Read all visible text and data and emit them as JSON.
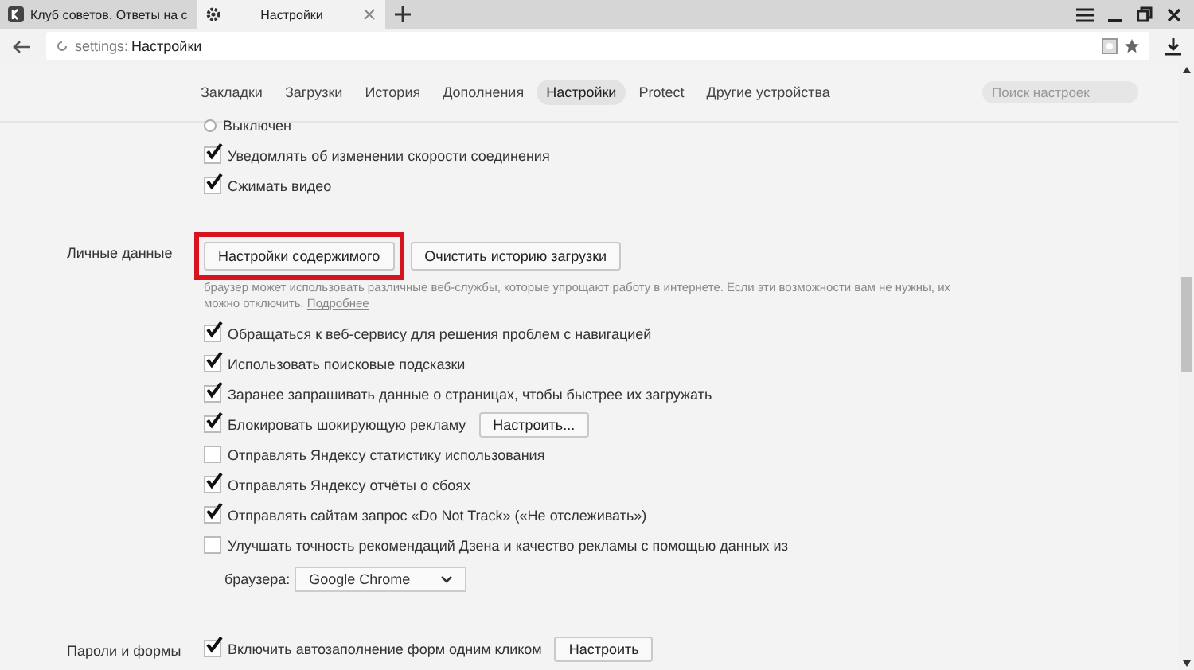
{
  "tabs": [
    {
      "title": "Клуб советов. Ответы на с",
      "selected": false
    },
    {
      "title": "Настройки",
      "selected": true
    }
  ],
  "address_bar": {
    "scheme": "settings:",
    "title": "Настройки"
  },
  "nav": {
    "items": [
      {
        "label": "Закладки",
        "selected": false
      },
      {
        "label": "Загрузки",
        "selected": false
      },
      {
        "label": "История",
        "selected": false
      },
      {
        "label": "Дополнения",
        "selected": false
      },
      {
        "label": "Настройки",
        "selected": true
      },
      {
        "label": "Protect",
        "selected": false
      },
      {
        "label": "Другие устройства",
        "selected": false
      }
    ],
    "search": {
      "placeholder": "Поиск настроек"
    }
  },
  "sections": [
    {
      "rows": [
        {
          "kind": "radio",
          "label": "Выключен",
          "selected": false
        },
        {
          "kind": "checkbox",
          "label": "Уведомлять об изменении скорости соединения",
          "checked": true
        },
        {
          "kind": "checkbox",
          "label": "Сжимать видео",
          "checked": true
        }
      ]
    },
    {
      "label": "Личные данные",
      "rows": [
        {
          "kind": "buttons",
          "buttons": [
            {
              "label": "Настройки содержимого",
              "highlighted": true
            },
            {
              "label": "Очистить историю загрузки",
              "highlighted": false
            }
          ]
        },
        {
          "kind": "description",
          "text": "браузер может использовать различные веб-службы, которые упрощают работу в интернете. Если эти возможности вам не нужны, их можно отключить.",
          "link": "Подробнее"
        },
        {
          "kind": "checkbox",
          "label": "Обращаться к веб-сервису для решения проблем с навигацией",
          "checked": true
        },
        {
          "kind": "checkbox",
          "label": "Использовать поисковые подсказки",
          "checked": true
        },
        {
          "kind": "checkbox",
          "label": "Заранее запрашивать данные о страницах, чтобы быстрее их загружать",
          "checked": true
        },
        {
          "kind": "checkbox",
          "label": "Блокировать шокирующую рекламу",
          "checked": true,
          "button": "Настроить..."
        },
        {
          "kind": "checkbox",
          "label": "Отправлять Яндексу статистику использования",
          "checked": false
        },
        {
          "kind": "checkbox",
          "label": "Отправлять Яндексу отчёты о сбоях",
          "checked": true
        },
        {
          "kind": "checkbox",
          "label": "Отправлять сайтам запрос «Do Not Track» («Не отслеживать»)",
          "checked": true
        },
        {
          "kind": "checkbox",
          "label": "Улучшать точность рекомендаций Дзена и качество рекламы с помощью данных из",
          "checked": false
        },
        {
          "kind": "select",
          "label": "браузера:",
          "value": "Google Chrome"
        }
      ]
    },
    {
      "label": "Пароли и формы",
      "rows": [
        {
          "kind": "checkbox",
          "label": "Включить автозаполнение форм одним кликом",
          "checked": true,
          "button": "Настроить"
        }
      ]
    }
  ]
}
